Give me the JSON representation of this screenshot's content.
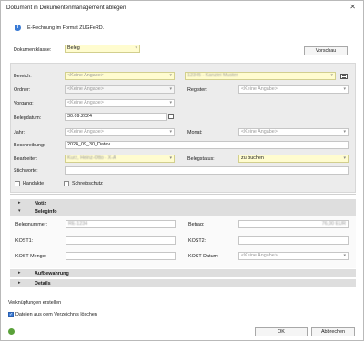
{
  "window": {
    "title": "Dokument in Dokumentenmanagement ablegen",
    "close_glyph": "✕"
  },
  "info": {
    "text": "E-Rechnung im Format ZUGFeRD."
  },
  "dokumentklasse": {
    "label": "Dokumentklasse:",
    "value": "Beleg",
    "preview_button": "Vorschau"
  },
  "form": {
    "bereich_label": "Bereich:",
    "bereich_value": "<Keine Angabe>",
    "bereich2_value": "12345 - Kanzlei Muster",
    "ordner_label": "Ordner:",
    "ordner_value": "<Keine Angabe>",
    "register_label": "Register:",
    "register_value": "<Keine Angabe>",
    "vorgang_label": "Vorgang:",
    "vorgang_value": "<Keine Angabe>",
    "belegdatum_label": "Belegdatum:",
    "belegdatum_value": "30.09.2024",
    "jahr_label": "Jahr:",
    "jahr_value": "<Keine Angabe>",
    "monat_label": "Monat:",
    "monat_value": "<Keine Angabe>",
    "beschreibung_label": "Beschreibung:",
    "beschreibung_value": "2024_09_30_Datev",
    "bearbeiter_label": "Bearbeiter:",
    "bearbeiter_value": "Kurz, Heinz-Otto - X-A",
    "belegstatus_label": "Belegstatus:",
    "belegstatus_value": "zu buchen",
    "stichworte_label": "Stichworte:",
    "stichworte_value": "",
    "handakte_label": "Handakte",
    "schreibschutz_label": "Schreibschutz"
  },
  "sections": {
    "notiz": "Notiz",
    "beleginfo": "Beleginfo",
    "aufbewahrung": "Aufbewahrung",
    "details": "Details"
  },
  "beleginfo": {
    "belegnummer_label": "Belegnummer:",
    "belegnummer_value": "RE-1234",
    "betrag_label": "Betrag:",
    "betrag_value": "76,00 EUR",
    "kost1_label": "KOST1:",
    "kost2_label": "KOST2:",
    "kostmenge_label": "KOST-Menge:",
    "kostdatum_label": "KOST-Datum:",
    "kostdatum_value": "<Keine Angabe>"
  },
  "links": {
    "title": "Verknüpfungen erstellen",
    "delete_files_label": "Dateien aus dem Verzeichnis löschen"
  },
  "footer": {
    "ok": "OK",
    "cancel": "Abbrechen"
  },
  "colors": {
    "required_field": "#fffccf",
    "accent": "#3a7bd5"
  }
}
